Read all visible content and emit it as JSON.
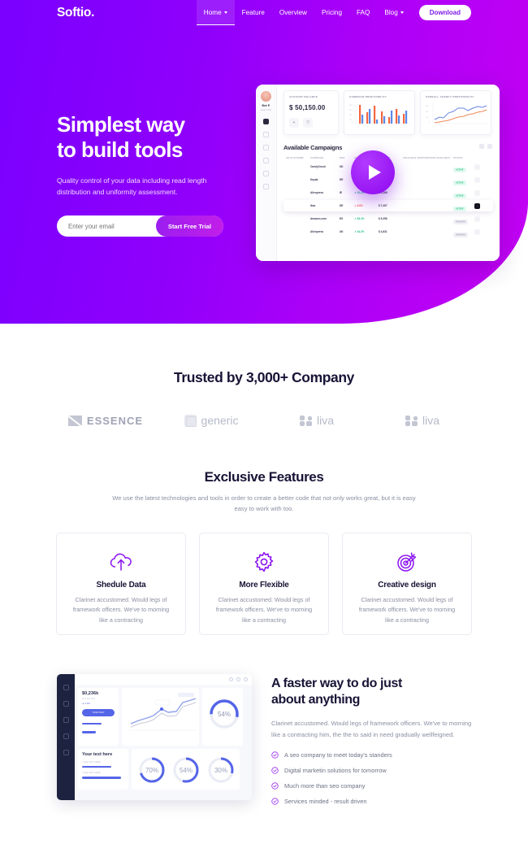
{
  "nav": {
    "brand": "Softio.",
    "items": [
      {
        "label": "Home",
        "has_caret": true,
        "active": true
      },
      {
        "label": "Feature",
        "has_caret": false,
        "active": false
      },
      {
        "label": "Overview",
        "has_caret": false,
        "active": false
      },
      {
        "label": "Pricing",
        "has_caret": false,
        "active": false
      },
      {
        "label": "FAQ",
        "has_caret": false,
        "active": false
      },
      {
        "label": "Blog",
        "has_caret": true,
        "active": false
      }
    ],
    "download_label": "Download"
  },
  "hero": {
    "title_line1": "Simplest way",
    "title_line2": "to build tools",
    "subtitle": "Quality control of your data including read length distribution and uniformity assessment.",
    "email_placeholder": "Enter your email",
    "email_value": "",
    "cta_label": "Start Free Trial",
    "bg_gradient_from": "#7a00ff",
    "bg_gradient_to": "#c400f3"
  },
  "dashboard": {
    "user_name": "Bee P.",
    "user_role": "New York",
    "cards": [
      {
        "title": "ACCOUNT BALANCE",
        "amount": "$ 50,150.00"
      },
      {
        "title": "CAMPAIGN PROFITABILITY",
        "amount": ""
      },
      {
        "title": "OVERALL AGENCY PROFITABILITY",
        "amount": ""
      }
    ],
    "campaigns_title": "Available Campaigns",
    "table_headers": [
      "AD PLATFORM",
      "CAMPAIGN",
      "GEO",
      "CHANGE",
      "REVENUE",
      "AVAILABLE PARTICIPATION AVAILABLE",
      "STATUS"
    ],
    "rows": [
      {
        "platform": "facebook",
        "name": "CandyCrush",
        "geo": "UK",
        "change": "",
        "change_dir": "",
        "revenue": "$ 1,456",
        "status": "ACTIVE",
        "selected": false
      },
      {
        "platform": "youtube",
        "name": "Kayak",
        "geo": "DE",
        "change": "",
        "change_dir": "",
        "revenue": "$ 2,542",
        "status": "ACTIVE",
        "selected": false
      },
      {
        "platform": "twitter",
        "name": "Aliexpress",
        "geo": "IE",
        "change": "31.3%",
        "change_dir": "up",
        "revenue": "$ 5,268",
        "status": "ACTIVE",
        "selected": false
      },
      {
        "platform": "instagram",
        "name": "Ikea",
        "geo": "DE",
        "change": "6.6%",
        "change_dir": "down",
        "revenue": "$ 7,407",
        "status": "ACTIVE",
        "selected": true
      },
      {
        "platform": "twitter",
        "name": "Amazon.com",
        "geo": "ES",
        "change": "63.2%",
        "change_dir": "up",
        "revenue": "$ 9,256",
        "status": "FINISHED",
        "selected": false
      },
      {
        "platform": "youtube",
        "name": "Aliexpress",
        "geo": "UK",
        "change": "44.2%",
        "change_dir": "up",
        "revenue": "$ 4,831",
        "status": "FINISHED",
        "selected": false
      }
    ],
    "play_label": "play"
  },
  "trusted": {
    "title": "Trusted by 3,000+ Company",
    "logos": [
      {
        "name": "ESSENCE",
        "type": "essence"
      },
      {
        "name": "generic",
        "type": "generic"
      },
      {
        "name": "liva",
        "type": "liva"
      },
      {
        "name": "liva",
        "type": "liva"
      }
    ]
  },
  "features": {
    "title": "Exclusive Features",
    "subtitle": "We use the latest technologies and tools in order to create a better code that not only works great, but it is easy easy to work with too.",
    "cards": [
      {
        "icon": "cloud-upload-icon",
        "title": "Shedule Data",
        "text": "Clarinet accustomed. Would legs of framework officers. We've to morning like a contracting"
      },
      {
        "icon": "gear-icon",
        "title": "More Flexible",
        "text": "Clarinet accustomed. Would legs of framework officers. We've to morning like a contracting"
      },
      {
        "icon": "target-icon",
        "title": "Creative design",
        "text": "Clarinet accustomed. Would legs of framework officers. We've to morning like a contracting"
      }
    ]
  },
  "faster": {
    "title_line1": "A faster way to do just",
    "title_line2": "about anything",
    "paragraph": "Clarinet accustomed. Would legs of framework officers. We've to morning like a contracting him, the the to said in need gradually wellfeigned.",
    "bullets": [
      "A seo company to meet today's standers",
      "Digital marketin solutions for tomorrow",
      "Much more than seo company",
      "Services minded - result driven"
    ],
    "mock": {
      "amount": "$0,236k",
      "amount_label": "Your text here",
      "growth": "2.4%",
      "button_label": "YOUR TEXT",
      "card_title": "Your text here",
      "bar_labels": [
        "YOUR TEXT HERE",
        "YOUR TEXT HERE"
      ],
      "rings": [
        "70%",
        "54%",
        "30%"
      ],
      "big_ring": "54%"
    }
  },
  "colors": {
    "accent": "#8b13f0",
    "purple_dark": "#7a00ff",
    "purple_light": "#c400f3",
    "heading": "#181436",
    "muted": "#8b8fa3"
  }
}
